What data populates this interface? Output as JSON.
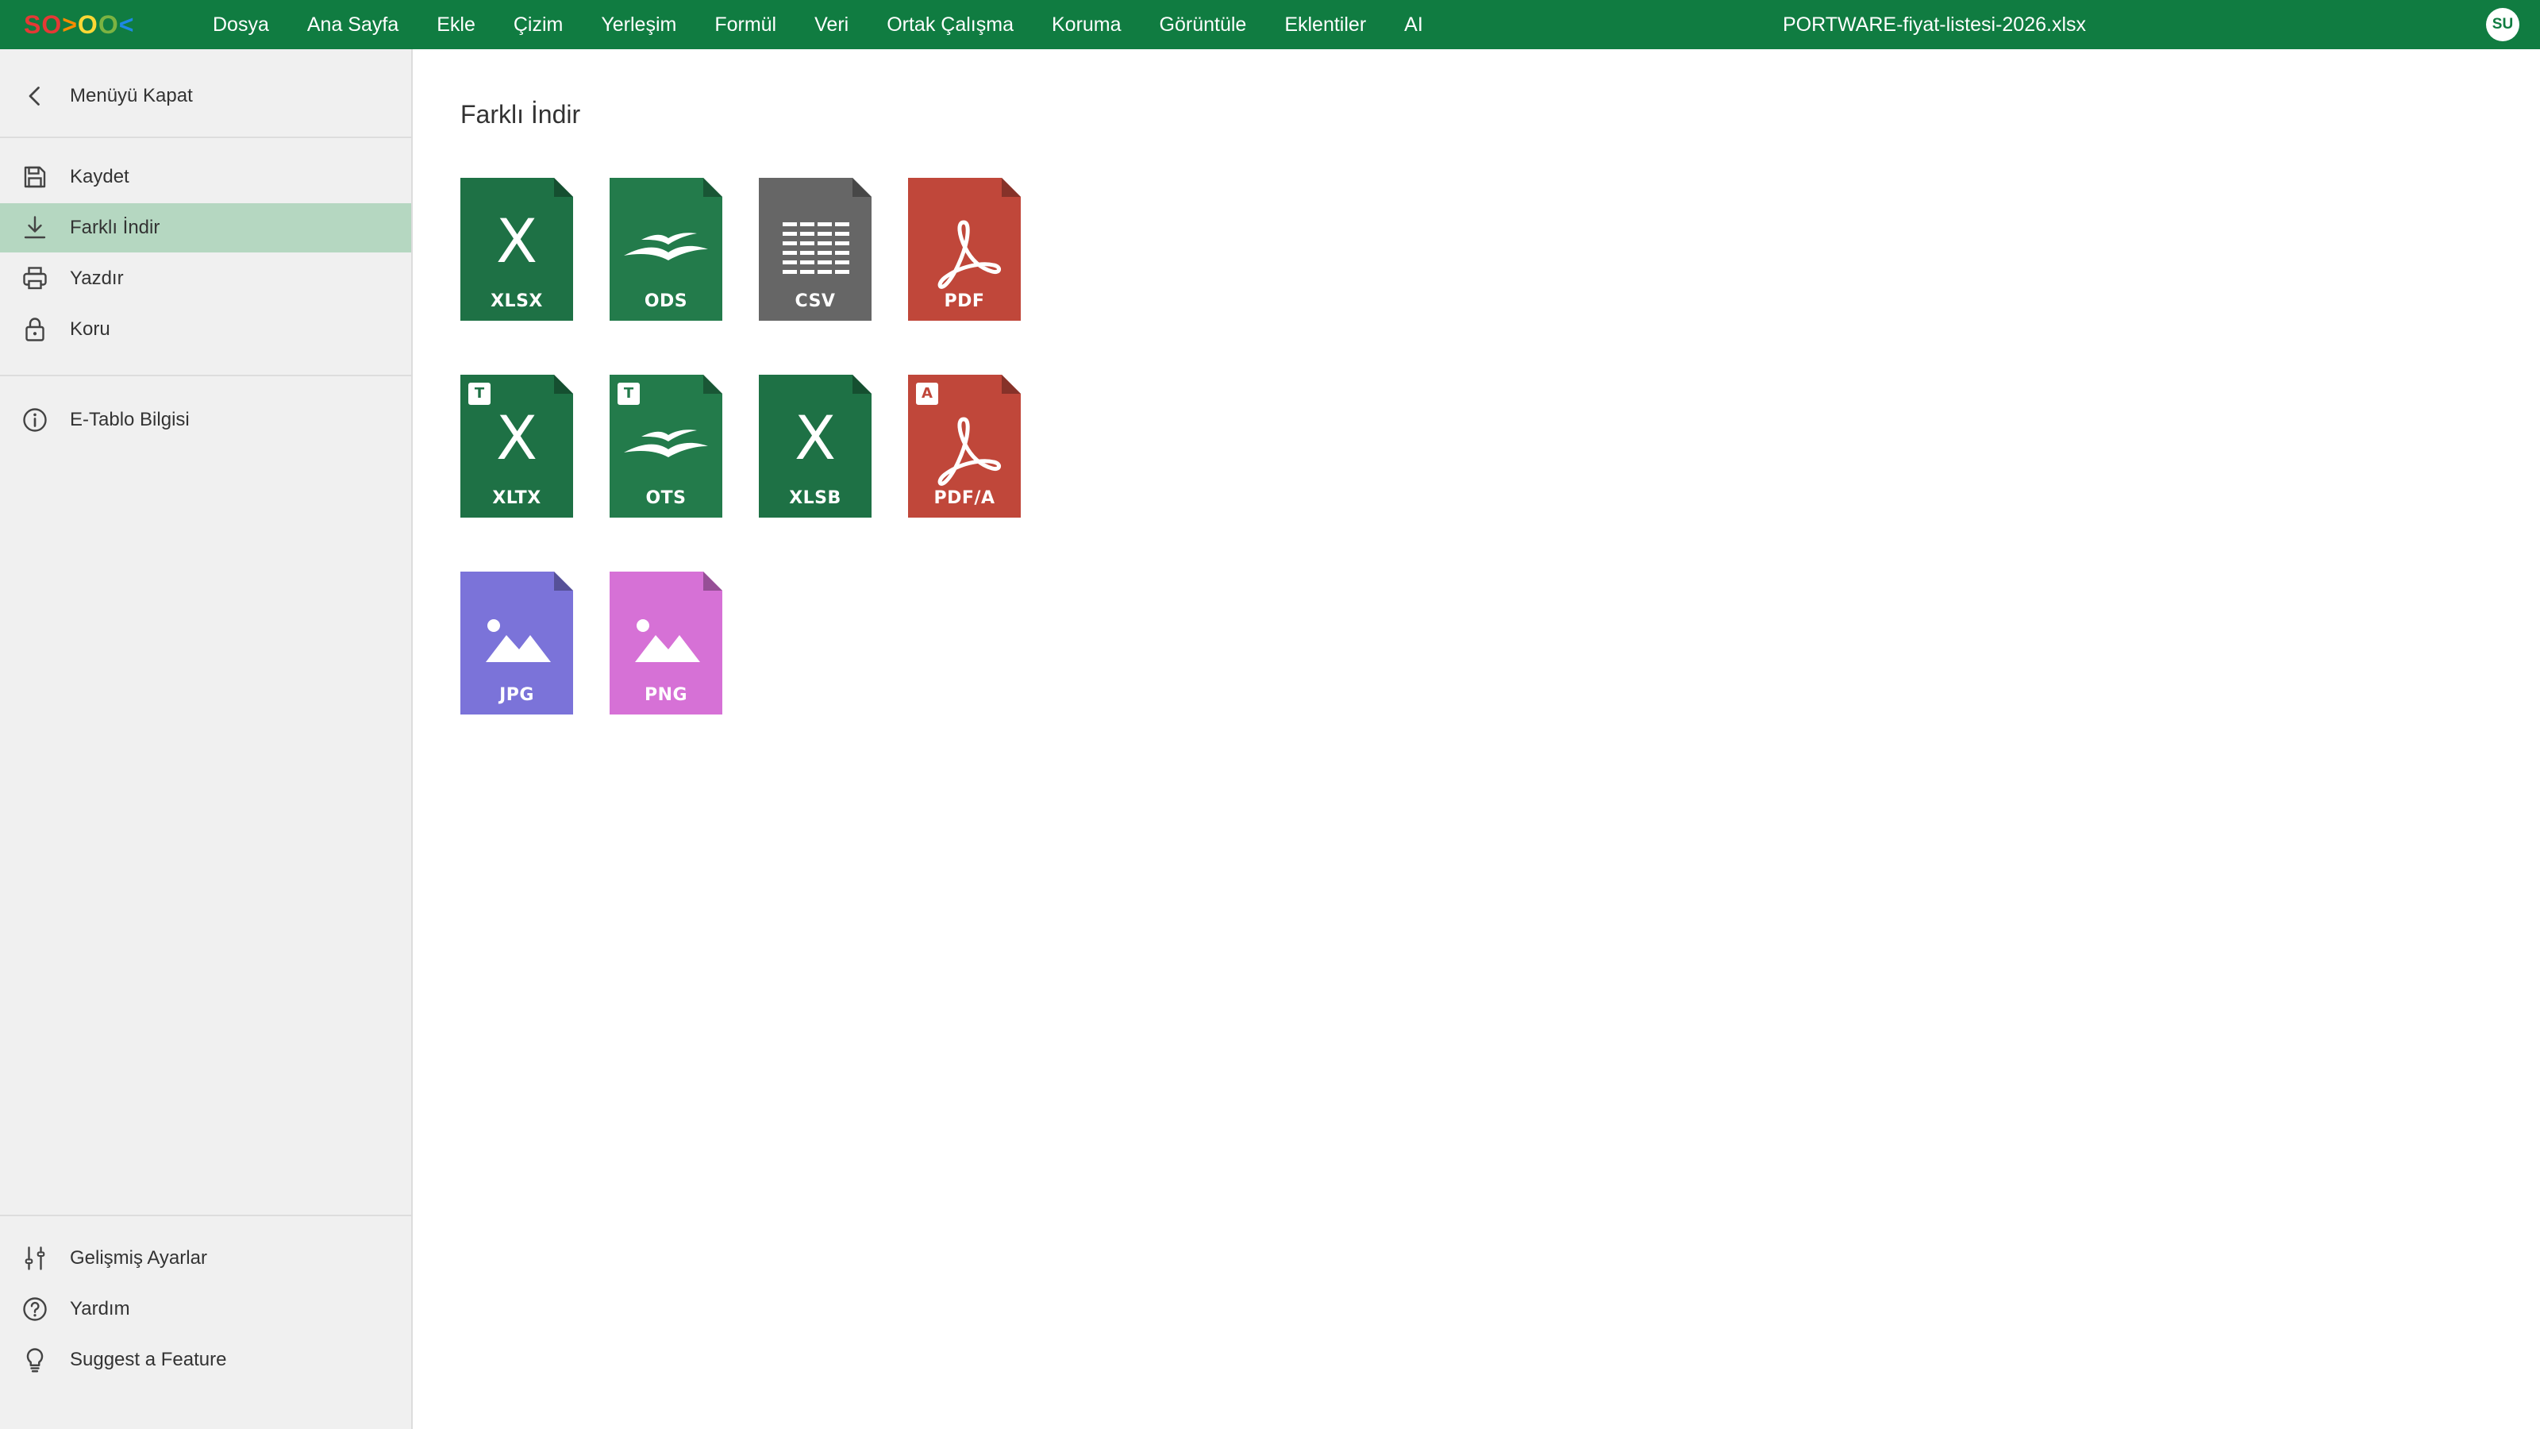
{
  "app": {
    "logo_text": [
      "S",
      "O",
      ">",
      "O",
      "O",
      "<"
    ],
    "document_title": "PORTWARE-fiyat-listesi-2026.xlsx",
    "avatar_initials": "SU",
    "colors": {
      "topbar": "#107c41",
      "sidebar_active": "#b5d7c1"
    }
  },
  "menu": {
    "items": [
      "Dosya",
      "Ana Sayfa",
      "Ekle",
      "Çizim",
      "Yerleşim",
      "Formül",
      "Veri",
      "Ortak Çalışma",
      "Koruma",
      "Görüntüle",
      "Eklentiler",
      "AI"
    ]
  },
  "sidebar": {
    "close_menu": {
      "label": "Menüyü Kapat",
      "icon": "chevron-left-icon"
    },
    "items": [
      {
        "label": "Kaydet",
        "icon": "save-icon",
        "active": false
      },
      {
        "label": "Farklı İndir",
        "icon": "download-icon",
        "active": true
      },
      {
        "label": "Yazdır",
        "icon": "print-icon",
        "active": false
      },
      {
        "label": "Koru",
        "icon": "lock-icon",
        "active": false
      }
    ],
    "info": {
      "label": "E-Tablo Bilgisi",
      "icon": "info-icon"
    },
    "bottom": [
      {
        "label": "Gelişmiş Ayarlar",
        "icon": "sliders-icon"
      },
      {
        "label": "Yardım",
        "icon": "help-icon"
      },
      {
        "label": "Suggest a Feature",
        "icon": "lightbulb-icon"
      }
    ]
  },
  "main": {
    "title": "Farklı İndir",
    "formats": [
      {
        "ext": "XLSX",
        "color": "#1e7145",
        "glyph": "x-letter",
        "badge": ""
      },
      {
        "ext": "ODS",
        "color": "#237b4b",
        "glyph": "gulls",
        "badge": ""
      },
      {
        "ext": "CSV",
        "color": "#666666",
        "glyph": "grid",
        "badge": ""
      },
      {
        "ext": "PDF",
        "color": "#c0473a",
        "glyph": "acrobat",
        "badge": ""
      },
      {
        "ext": "XLTX",
        "color": "#1e7145",
        "glyph": "x-letter",
        "badge": "T"
      },
      {
        "ext": "OTS",
        "color": "#237b4b",
        "glyph": "gulls",
        "badge": "T"
      },
      {
        "ext": "XLSB",
        "color": "#1e7145",
        "glyph": "x-letter",
        "badge": ""
      },
      {
        "ext": "PDF/A",
        "color": "#c0473a",
        "glyph": "acrobat",
        "badge": "A"
      },
      {
        "ext": "JPG",
        "color": "#7b73d9",
        "glyph": "picture",
        "badge": ""
      },
      {
        "ext": "PNG",
        "color": "#d671d6",
        "glyph": "picture",
        "badge": ""
      }
    ]
  }
}
